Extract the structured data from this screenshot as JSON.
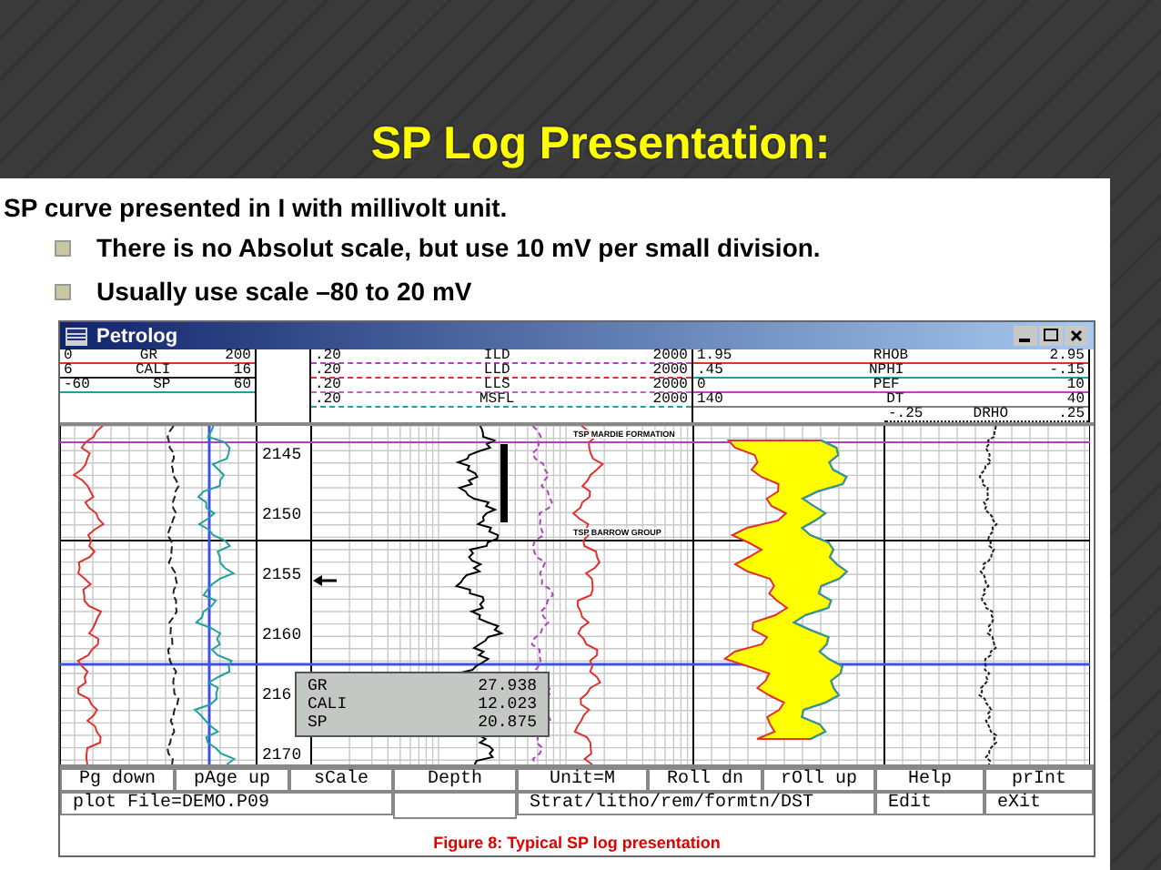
{
  "slide": {
    "title": "SP Log Presentation:",
    "intro": "SP curve presented in I with millivolt unit.",
    "bullets": [
      "There is no Absolut scale, but use 10 mV per small division.",
      "Usually use scale –80 to 20 mV"
    ]
  },
  "window": {
    "title": "Petrolog"
  },
  "track_1_scales": [
    {
      "min": "0",
      "name": "GR",
      "max": "200",
      "color": "#e03030"
    },
    {
      "min": "6",
      "name": "CALI",
      "max": "16",
      "color": "#202020"
    },
    {
      "min": "-60",
      "name": "SP",
      "max": "60",
      "color": "#20a0a0"
    }
  ],
  "track_2_scales": [
    {
      "min": ".20",
      "name": "ILD",
      "max": "2000",
      "color": "#b040c0"
    },
    {
      "min": ".20",
      "name": "LLD",
      "max": "2000",
      "color": "#e03030"
    },
    {
      "min": ".20",
      "name": "LLS",
      "max": "2000",
      "color": "#c060c0"
    },
    {
      "min": ".20",
      "name": "MSFL",
      "max": "2000",
      "color": "#20a0a0"
    }
  ],
  "track_3_scales": [
    {
      "min": "1.95",
      "name": "RHOB",
      "max": "2.95",
      "color": "#e03030"
    },
    {
      "min": ".45",
      "name": "NPHI",
      "max": "-.15",
      "color": "#20a0a0"
    },
    {
      "min": "0",
      "name": "PEF",
      "max": "10",
      "color": "#c040c0"
    },
    {
      "min": "140",
      "name": "DT",
      "max": "40",
      "color": "#808080"
    }
  ],
  "track_4_scales": [
    {
      "min": "-.25",
      "name": "DRHO",
      "max": ".25",
      "color": "#202020"
    }
  ],
  "depths": [
    "2145",
    "2150",
    "2155",
    "2160",
    "216",
    "2170"
  ],
  "formation_tops": [
    "TSP MARDIE FORMATION",
    "TSP BARROW GROUP"
  ],
  "readout": [
    {
      "name": "GR",
      "value": "27.938"
    },
    {
      "name": "CALI",
      "value": "12.023"
    },
    {
      "name": "SP",
      "value": "20.875"
    }
  ],
  "menu_row_1": [
    "Pg down",
    "pAge up",
    "sCale",
    "Depth",
    "Unit=M",
    "Roll dn",
    "rOll up",
    "Help",
    "prInt"
  ],
  "menu_row_2": [
    "plot File=DEMO.P09",
    "Strat/litho/rem/formtn/DST",
    "Edit",
    "eXit"
  ],
  "caption": "Figure 8: Typical SP log presentation"
}
